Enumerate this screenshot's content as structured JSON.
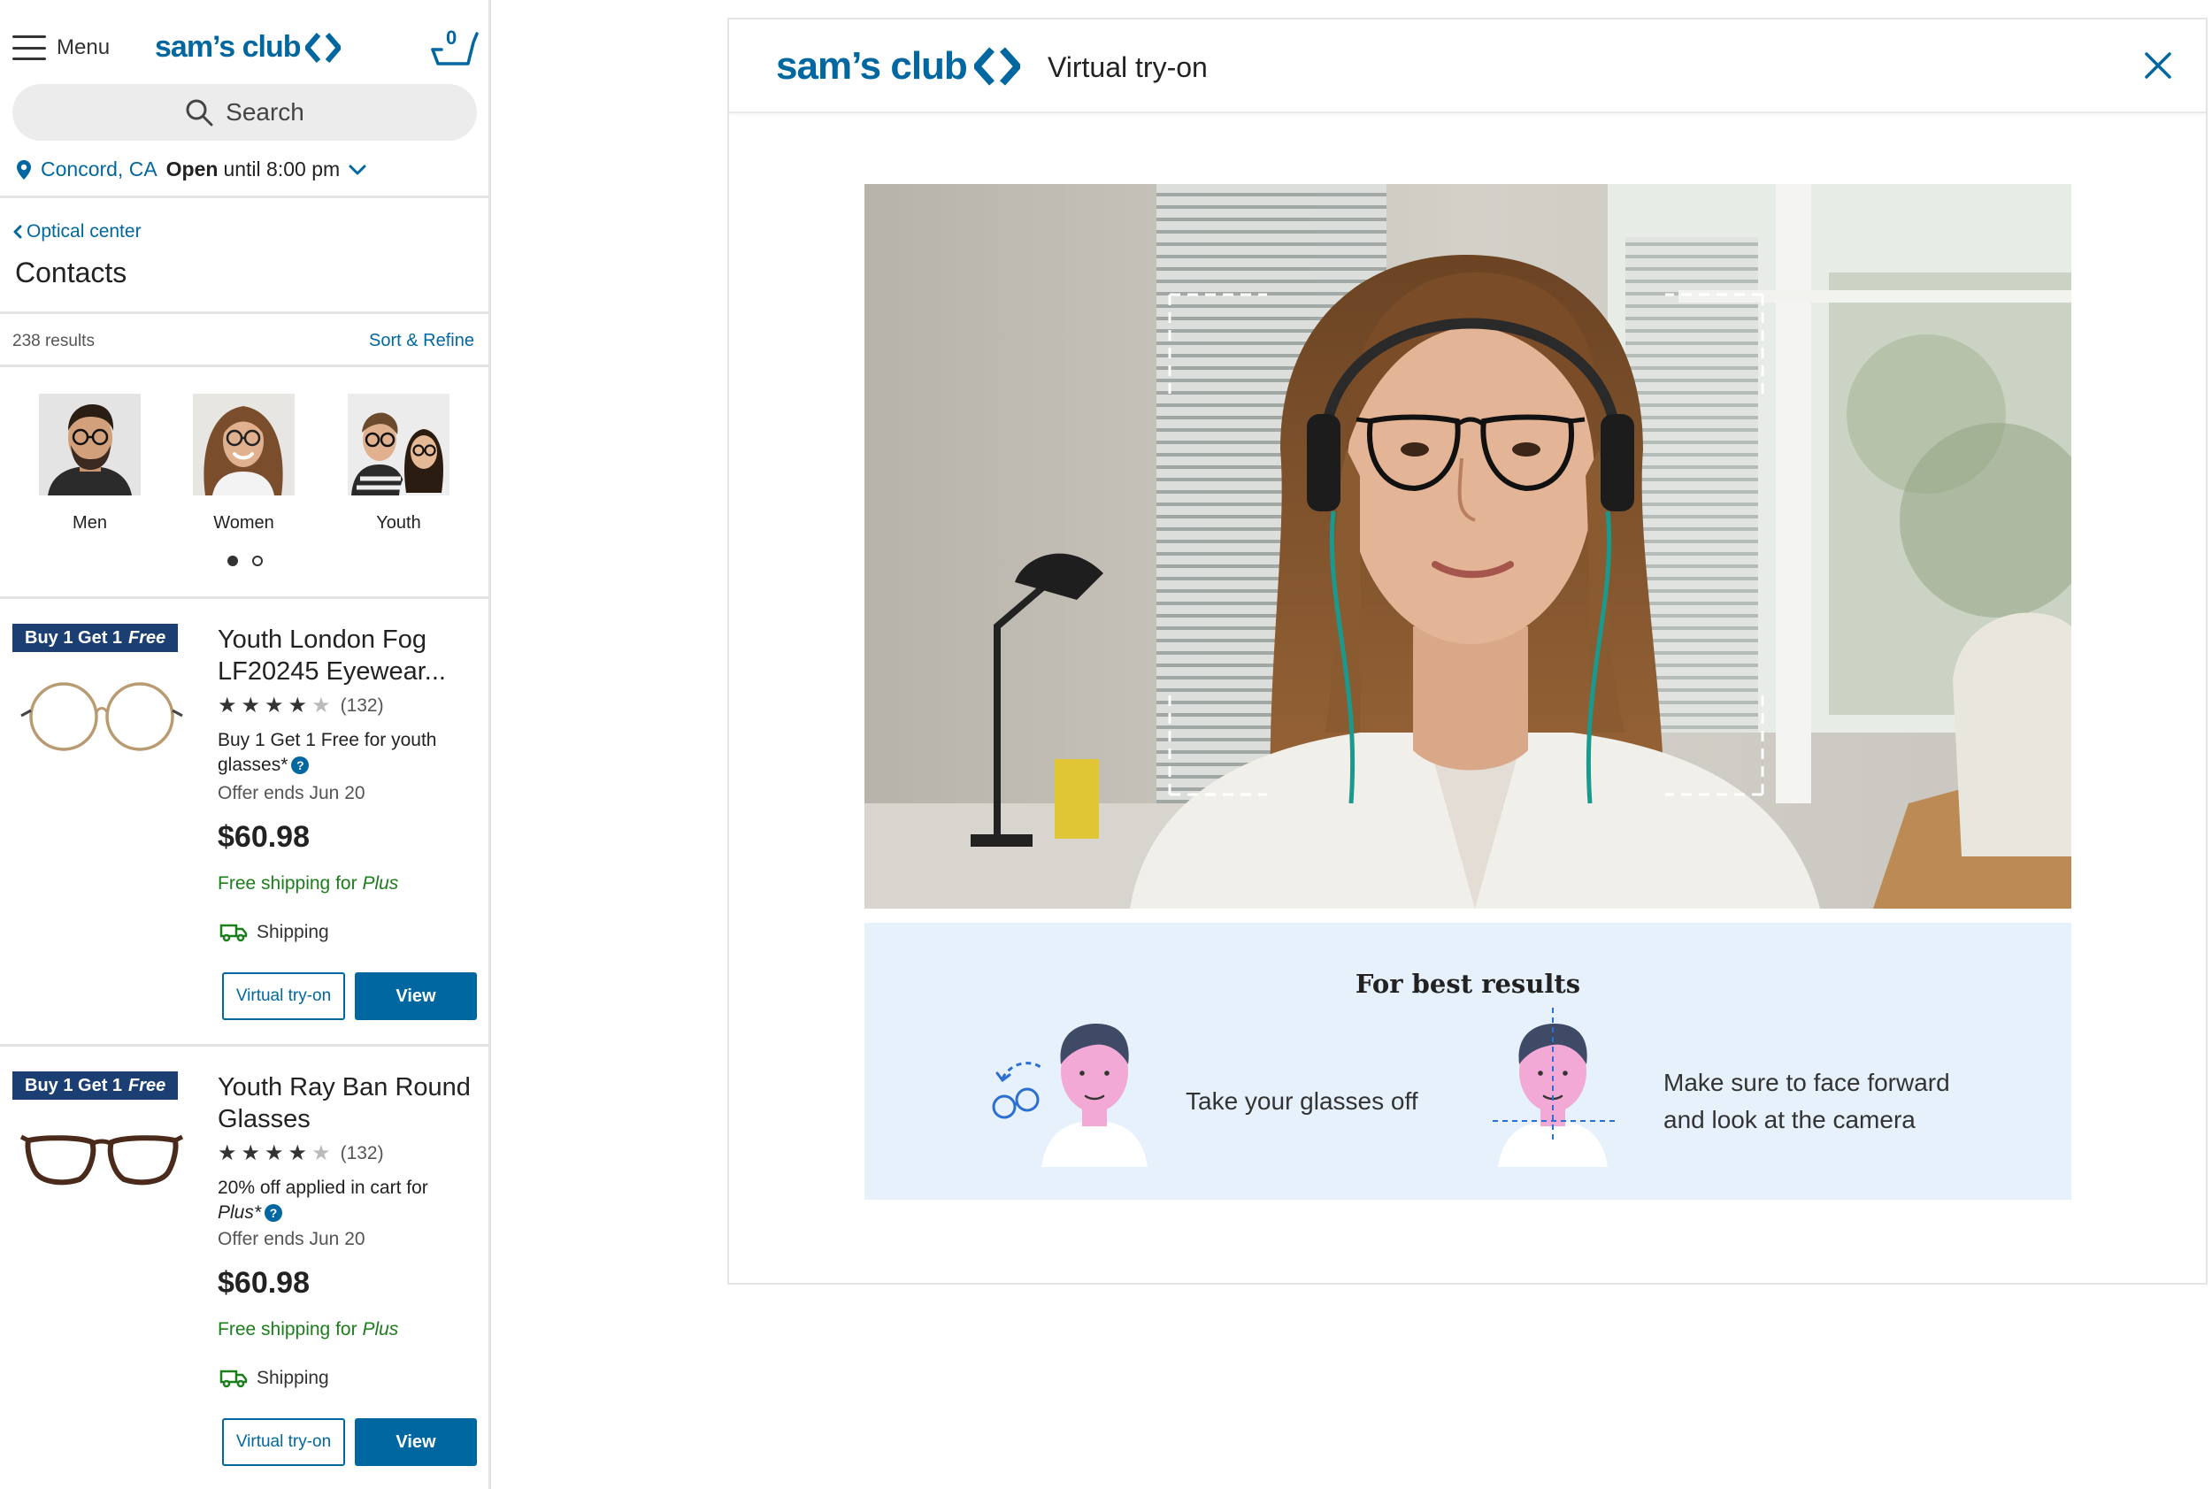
{
  "mobile": {
    "menu_label": "Menu",
    "logo_text": "sam’s club",
    "cart_count": "0",
    "search_placeholder": "Search",
    "location": {
      "city": "Concord, CA",
      "open": "Open",
      "hours": "until 8:00 pm"
    },
    "breadcrumb": "Optical center",
    "page_title": "Contacts",
    "results_count": "238 results",
    "sort_refine": "Sort & Refine",
    "categories": [
      {
        "label": "Men"
      },
      {
        "label": "Women"
      },
      {
        "label": "Youth"
      }
    ],
    "products": [
      {
        "badge_main": "Buy 1 Get 1",
        "badge_em": "Free",
        "name": "Youth London Fog LF20245 Eyewear...",
        "rating": 4,
        "review_count": "(132)",
        "promo": "Buy 1 Get 1 Free for youth glasses*",
        "offer_ends": "Offer ends Jun 20",
        "price": "$60.98",
        "free_shipping": "Free shipping for",
        "free_shipping_em": "Plus",
        "shipping": "Shipping",
        "try_on_label": "Virtual try-on",
        "view_label": "View",
        "frame_color": "#b89b70"
      },
      {
        "badge_main": "Buy 1 Get 1",
        "badge_em": "Free",
        "name": "Youth Ray Ban Round Glasses",
        "rating": 4,
        "review_count": "(132)",
        "promo_line1": "20% off applied in cart for",
        "promo_line2": "Plus*",
        "offer_ends": "Offer ends Jun 20",
        "price": "$60.98",
        "free_shipping": "Free shipping for",
        "free_shipping_em": "Plus",
        "shipping": "Shipping",
        "try_on_label": "Virtual try-on",
        "view_label": "View",
        "frame_color": "#4a2a1a"
      }
    ]
  },
  "modal": {
    "logo_text": "sam’s club",
    "title": "Virtual try-on",
    "tips_title": "For best results",
    "tip1": "Take your glasses off",
    "tip2_line1": "Make sure to face forward",
    "tip2_line2": "and look at the camera"
  },
  "colors": {
    "brand_blue": "#0067a0",
    "badge_navy": "#1c3f73",
    "shipping_green": "#1a7f1a",
    "tips_bg": "#e7f1fb"
  }
}
